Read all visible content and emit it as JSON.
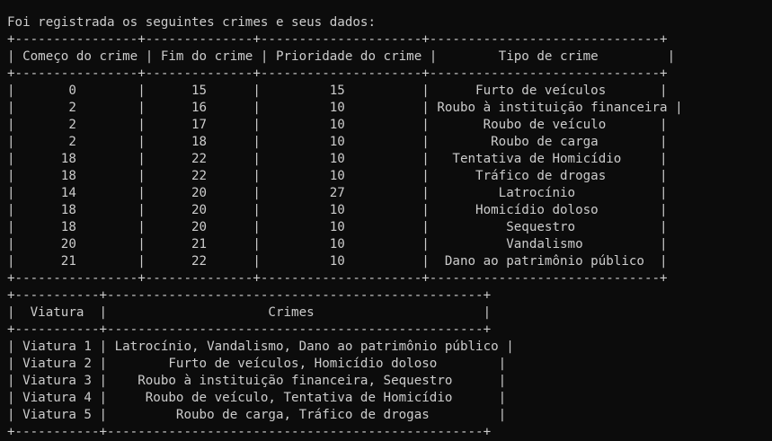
{
  "terminal": {
    "lines": [
      "Foi registrada os seguintes crimes e seus dados:",
      "+----------------+--------------+---------------------+------------------------------+",
      "| Começo do crime | Fim do crime | Prioridade do crime |        Tipo de crime         |",
      "+----------------+--------------+---------------------+------------------------------+",
      "|       0        |      15      |         15          |      Furto de veículos       |",
      "|       2        |      16      |         10          | Roubo à instituição financeira |",
      "|       2        |      17      |         10          |       Roubo de veículo       |",
      "|       2        |      18      |         10          |        Roubo de carga        |",
      "|      18        |      22      |         10          |   Tentativa de Homicídio     |",
      "|      18        |      22      |         10          |      Tráfico de drogas       |",
      "|      14        |      20      |         27          |         Latrocínio           |",
      "|      18        |      20      |         10          |      Homicídio doloso        |",
      "|      18        |      20      |         10          |          Sequestro           |",
      "|      20        |      21      |         10          |          Vandalismo          |",
      "|      21        |      22      |         10          |  Dano ao patrimônio público  |",
      "+----------------+--------------+---------------------+------------------------------+",
      "+-----------+-------------------------------------------------+",
      "|  Viatura  |                     Crimes                      |",
      "+-----------+-------------------------------------------------+",
      "| Viatura 1 | Latrocínio, Vandalismo, Dano ao patrimônio público |",
      "| Viatura 2 |        Furto de veículos, Homicídio doloso        |",
      "| Viatura 3 |    Roubo à instituição financeira, Sequestro      |",
      "| Viatura 4 |     Roubo de veículo, Tentativa de Homicídio      |",
      "| Viatura 5 |         Roubo de carga, Tráfico de drogas         |",
      "+-----------+-------------------------------------------------+"
    ]
  }
}
